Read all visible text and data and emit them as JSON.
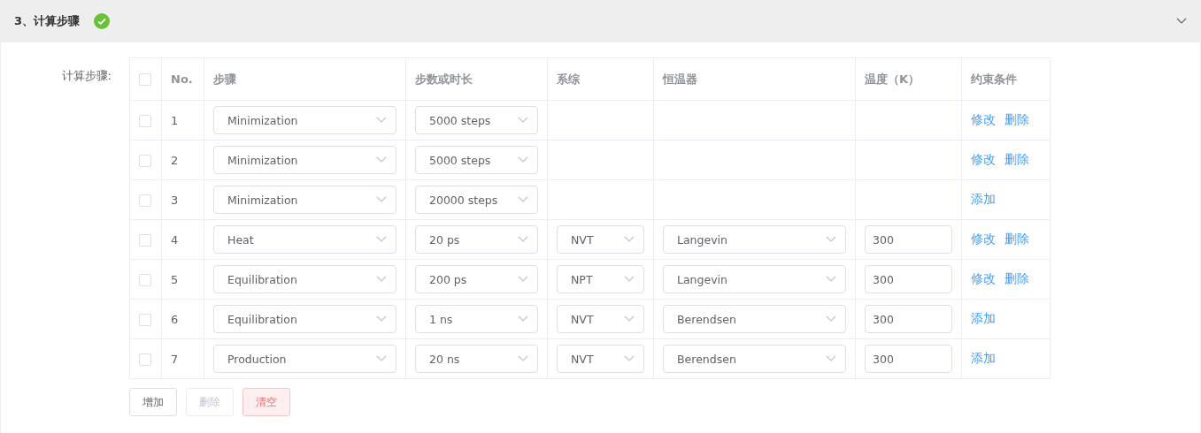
{
  "section": {
    "title": "3、计算步骤",
    "done": true,
    "expanded": true
  },
  "field_label": "计算步骤:",
  "table": {
    "select_all": {
      "checked": false
    },
    "columns": [
      "No.",
      "步骤",
      "步数或时长",
      "系综",
      "恒温器",
      "温度（K）",
      "约束条件"
    ],
    "rows": [
      {
        "checked": false,
        "no": "1",
        "step": "Minimization",
        "duration": "5000 steps",
        "actions": [
          "修改",
          "删除"
        ]
      },
      {
        "checked": false,
        "no": "2",
        "step": "Minimization",
        "duration": "5000 steps",
        "actions": [
          "修改",
          "删除"
        ]
      },
      {
        "checked": false,
        "no": "3",
        "step": "Minimization",
        "duration": "20000 steps",
        "actions": [
          "添加"
        ]
      },
      {
        "checked": false,
        "no": "4",
        "step": "Heat",
        "duration": "20 ps",
        "ensemble": "NVT",
        "thermostat": "Langevin",
        "temperature": "300",
        "actions": [
          "修改",
          "删除"
        ]
      },
      {
        "checked": false,
        "no": "5",
        "step": "Equilibration",
        "duration": "200 ps",
        "ensemble": "NPT",
        "thermostat": "Langevin",
        "temperature": "300",
        "actions": [
          "修改",
          "删除"
        ]
      },
      {
        "checked": false,
        "no": "6",
        "step": "Equilibration",
        "duration": "1 ns",
        "ensemble": "NVT",
        "thermostat": "Berendsen",
        "temperature": "300",
        "actions": [
          "添加"
        ]
      },
      {
        "checked": false,
        "no": "7",
        "step": "Production",
        "duration": "20 ns",
        "ensemble": "NVT",
        "thermostat": "Berendsen",
        "temperature": "300",
        "actions": [
          "添加"
        ]
      }
    ]
  },
  "buttons": [
    {
      "label": "增加",
      "kind": "default",
      "disabled": false
    },
    {
      "label": "删除",
      "kind": "default",
      "disabled": true
    },
    {
      "label": "清空",
      "kind": "danger",
      "disabled": false
    }
  ]
}
